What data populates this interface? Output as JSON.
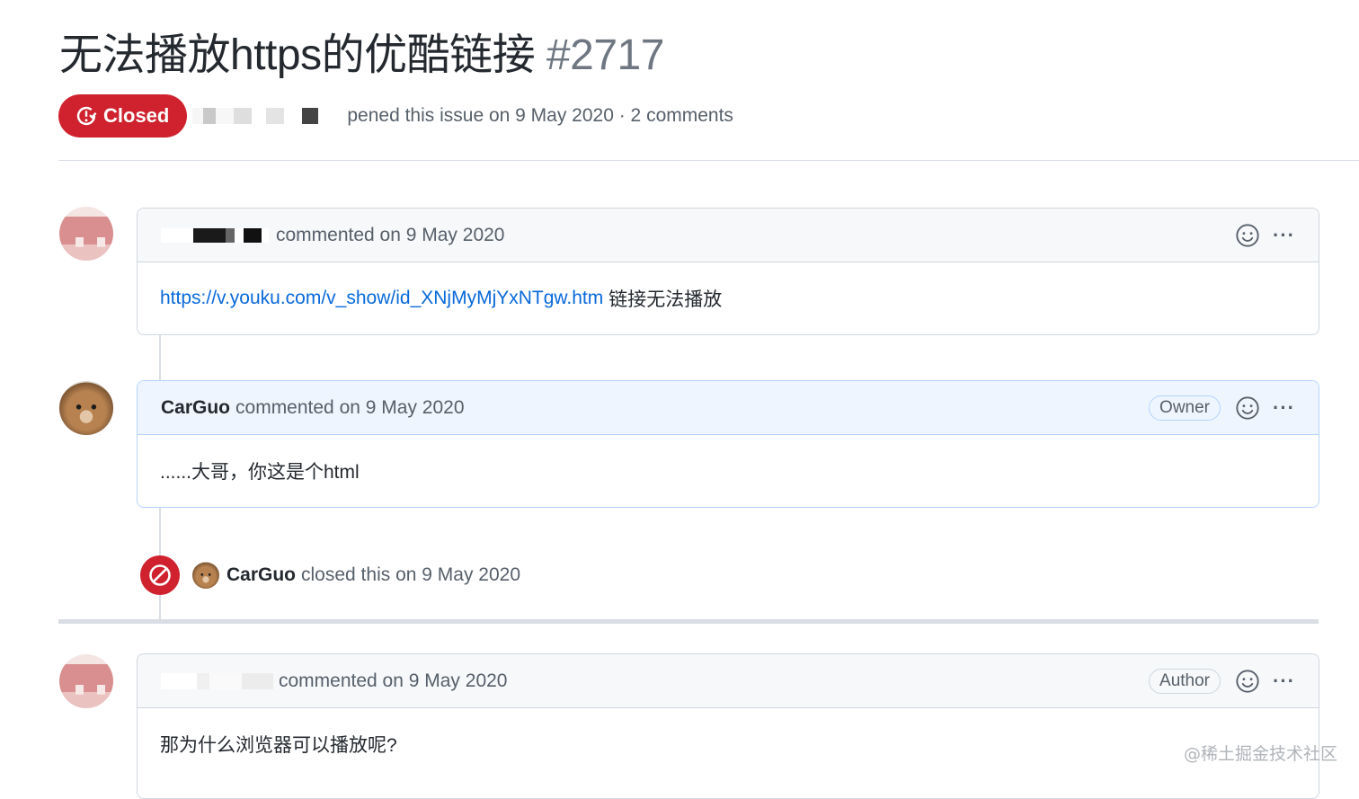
{
  "issue": {
    "title": "无法播放https的优酷链接",
    "number": "#2717",
    "state_label": "Closed",
    "meta_text": "pened this issue on 9 May 2020 · 2 comments"
  },
  "comments": [
    {
      "action": "commented on 9 May 2020",
      "link_text": "https://v.youku.com/v_show/id_XNjMyMjYxNTgw.htm",
      "body_text": "链接无法播放"
    },
    {
      "author": "CarGuo",
      "action": "commented on 9 May 2020",
      "role": "Owner",
      "body_text": "......大哥，你这是个html"
    },
    {
      "action": "commented on 9 May 2020",
      "role": "Author",
      "body_text": "那为什么浏览器可以播放呢?"
    }
  ],
  "event": {
    "author": "CarGuo",
    "text": "closed this on 9 May 2020"
  },
  "menu_glyph": "···",
  "watermark": "@稀土掘金技术社区",
  "icons": {
    "state": "issue-closed-icon",
    "event": "circle-slash-icon",
    "reaction": "smiley-icon",
    "menu": "kebab-horizontal-icon"
  },
  "colors": {
    "closed": "#cf222e",
    "link": "#0969da",
    "owner_header": "#eef5ff",
    "muted": "#57606a"
  }
}
